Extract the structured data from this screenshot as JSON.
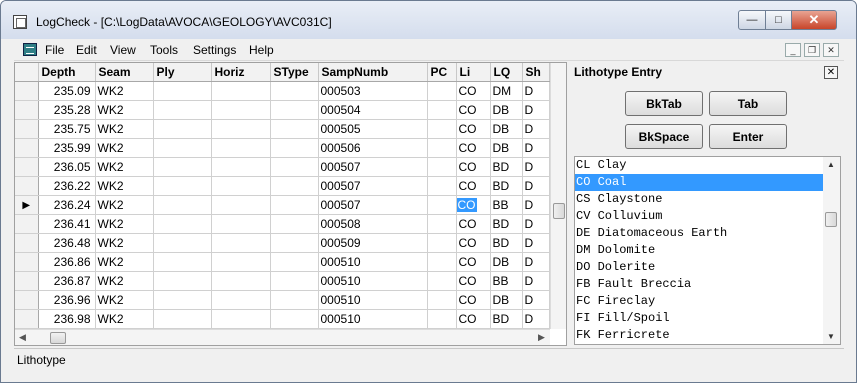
{
  "window": {
    "title": "LogCheck - [C:\\LogData\\AVOCA\\GEOLOGY\\AVC031C]",
    "min_glyph": "—",
    "max_glyph": "□",
    "close_glyph": "✕"
  },
  "menubar": {
    "items": [
      "File",
      "Edit",
      "View",
      "Tools",
      "Settings",
      "Help"
    ]
  },
  "mdi": {
    "min_glyph": "_",
    "restore_glyph": "❐",
    "close_glyph": "✕"
  },
  "grid": {
    "columns": [
      "",
      "Depth",
      "Seam",
      "Ply",
      "Horiz",
      "SType",
      "SampNumb",
      "PC",
      "Li",
      "LQ",
      "Sh",
      "I"
    ],
    "current_row_marker": "▶",
    "rows": [
      {
        "depth": "235.09",
        "seam": "WK2",
        "ply": "",
        "horiz": "",
        "stype": "",
        "sampnumb": "000503",
        "pc": "",
        "li": "CO",
        "lq": "DM",
        "sh": "D"
      },
      {
        "depth": "235.28",
        "seam": "WK2",
        "ply": "",
        "horiz": "",
        "stype": "",
        "sampnumb": "000504",
        "pc": "",
        "li": "CO",
        "lq": "DB",
        "sh": "D"
      },
      {
        "depth": "235.75",
        "seam": "WK2",
        "ply": "",
        "horiz": "",
        "stype": "",
        "sampnumb": "000505",
        "pc": "",
        "li": "CO",
        "lq": "DB",
        "sh": "D"
      },
      {
        "depth": "235.99",
        "seam": "WK2",
        "ply": "",
        "horiz": "",
        "stype": "",
        "sampnumb": "000506",
        "pc": "",
        "li": "CO",
        "lq": "DB",
        "sh": "D"
      },
      {
        "depth": "236.05",
        "seam": "WK2",
        "ply": "",
        "horiz": "",
        "stype": "",
        "sampnumb": "000507",
        "pc": "",
        "li": "CO",
        "lq": "BD",
        "sh": "D"
      },
      {
        "depth": "236.22",
        "seam": "WK2",
        "ply": "",
        "horiz": "",
        "stype": "",
        "sampnumb": "000507",
        "pc": "",
        "li": "CO",
        "lq": "BD",
        "sh": "D"
      },
      {
        "depth": "236.24",
        "seam": "WK2",
        "ply": "",
        "horiz": "",
        "stype": "",
        "sampnumb": "000507",
        "pc": "",
        "li": "CO",
        "lq": "BB",
        "sh": "D"
      },
      {
        "depth": "236.41",
        "seam": "WK2",
        "ply": "",
        "horiz": "",
        "stype": "",
        "sampnumb": "000508",
        "pc": "",
        "li": "CO",
        "lq": "BD",
        "sh": "D"
      },
      {
        "depth": "236.48",
        "seam": "WK2",
        "ply": "",
        "horiz": "",
        "stype": "",
        "sampnumb": "000509",
        "pc": "",
        "li": "CO",
        "lq": "BD",
        "sh": "D"
      },
      {
        "depth": "236.86",
        "seam": "WK2",
        "ply": "",
        "horiz": "",
        "stype": "",
        "sampnumb": "000510",
        "pc": "",
        "li": "CO",
        "lq": "DB",
        "sh": "D"
      },
      {
        "depth": "236.87",
        "seam": "WK2",
        "ply": "",
        "horiz": "",
        "stype": "",
        "sampnumb": "000510",
        "pc": "",
        "li": "CO",
        "lq": "BB",
        "sh": "D"
      },
      {
        "depth": "236.96",
        "seam": "WK2",
        "ply": "",
        "horiz": "",
        "stype": "",
        "sampnumb": "000510",
        "pc": "",
        "li": "CO",
        "lq": "DB",
        "sh": "D"
      },
      {
        "depth": "236.98",
        "seam": "WK2",
        "ply": "",
        "horiz": "",
        "stype": "",
        "sampnumb": "000510",
        "pc": "",
        "li": "CO",
        "lq": "BD",
        "sh": "D"
      }
    ],
    "current_row_index": 6,
    "selected_column": "li",
    "h_left_arrow": "◀",
    "h_right_arrow": "▶"
  },
  "panel": {
    "title": "Lithotype Entry",
    "close_glyph": "✕",
    "buttons": {
      "bktab": "BkTab",
      "tab": "Tab",
      "bkspace": "BkSpace",
      "enter": "Enter"
    },
    "list": [
      "CL Clay",
      "CO Coal",
      "CS Claystone",
      "CV Colluvium",
      "DE Diatomaceous Earth",
      "DM Dolomite",
      "DO Dolerite",
      "FB Fault Breccia",
      "FC Fireclay",
      "FI Fill/Spoil",
      "FK Ferricrete"
    ],
    "selected_index": 1,
    "up_arrow": "▲",
    "down_arrow": "▼"
  },
  "status": {
    "text": "Lithotype"
  },
  "colors": {
    "selection": "#3399ff",
    "close_button": "#c8452a"
  }
}
